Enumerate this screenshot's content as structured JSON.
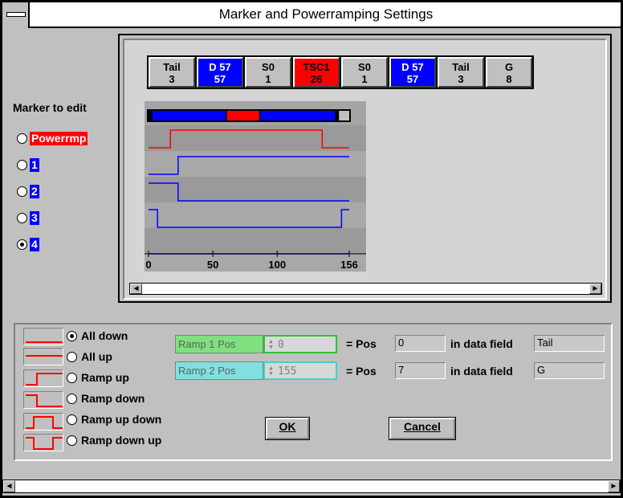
{
  "window": {
    "title": "Marker and Powerramping Settings"
  },
  "fields": [
    {
      "name": "Tail",
      "value": "3",
      "color": "gray"
    },
    {
      "name": "D 57",
      "value": "57",
      "color": "blue"
    },
    {
      "name": "S0",
      "value": "1",
      "color": "gray"
    },
    {
      "name": "TSC1",
      "value": "26",
      "color": "red"
    },
    {
      "name": "S0",
      "value": "1",
      "color": "gray"
    },
    {
      "name": "D 57",
      "value": "57",
      "color": "blue"
    },
    {
      "name": "Tail",
      "value": "3",
      "color": "gray"
    },
    {
      "name": "G",
      "value": "8",
      "color": "gray"
    }
  ],
  "scope": {
    "x_ticks": [
      "0",
      "50",
      "100",
      "156"
    ],
    "x_max": 156,
    "segments": [
      {
        "from": 0,
        "to": 3,
        "color": "#000000"
      },
      {
        "from": 3,
        "to": 60,
        "color": "#0000ff"
      },
      {
        "from": 60,
        "to": 61,
        "color": "#000000"
      },
      {
        "from": 61,
        "to": 86,
        "color": "#ff0000"
      },
      {
        "from": 86,
        "to": 87,
        "color": "#000000"
      },
      {
        "from": 87,
        "to": 145,
        "color": "#0000ff"
      },
      {
        "from": 145,
        "to": 148,
        "color": "#000000"
      },
      {
        "from": 148,
        "to": 156,
        "color": "#c0c0c0"
      }
    ],
    "traces": [
      {
        "color": "#ff0000",
        "low_first": true,
        "edges": [
          17,
          135
        ]
      },
      {
        "color": "#0000ff",
        "low_first": true,
        "edges": [
          23
        ]
      },
      {
        "color": "#0000ff",
        "low_first": false,
        "edges": [
          23
        ]
      },
      {
        "color": "#0000ff",
        "low_first": false,
        "edges": [
          7,
          150
        ]
      },
      {
        "color": "#0000ff",
        "low_first": true,
        "edges": []
      }
    ]
  },
  "markers": {
    "title": "Marker to edit",
    "items": [
      {
        "label": "Powerrmp",
        "color": "red",
        "selected": false
      },
      {
        "label": "1",
        "color": "blue",
        "selected": false
      },
      {
        "label": "2",
        "color": "blue",
        "selected": false
      },
      {
        "label": "3",
        "color": "blue",
        "selected": false
      },
      {
        "label": "4",
        "color": "blue",
        "selected": true
      }
    ]
  },
  "modes": [
    {
      "label": "All down",
      "selected": true
    },
    {
      "label": "All up",
      "selected": false
    },
    {
      "label": "Ramp up",
      "selected": false
    },
    {
      "label": "Ramp down",
      "selected": false
    },
    {
      "label": "Ramp up down",
      "selected": false
    },
    {
      "label": "Ramp down up",
      "selected": false
    }
  ],
  "ramp1": {
    "label": "Ramp 1 Pos",
    "value": "0",
    "pos_label": "= Pos",
    "pos": "0",
    "field_label": "in data field",
    "field": "Tail"
  },
  "ramp2": {
    "label": "Ramp 2 Pos",
    "value": "155",
    "pos_label": "= Pos",
    "pos": "7",
    "field_label": "in data field",
    "field": "G"
  },
  "buttons": {
    "ok": "OK",
    "cancel": "Cancel"
  }
}
